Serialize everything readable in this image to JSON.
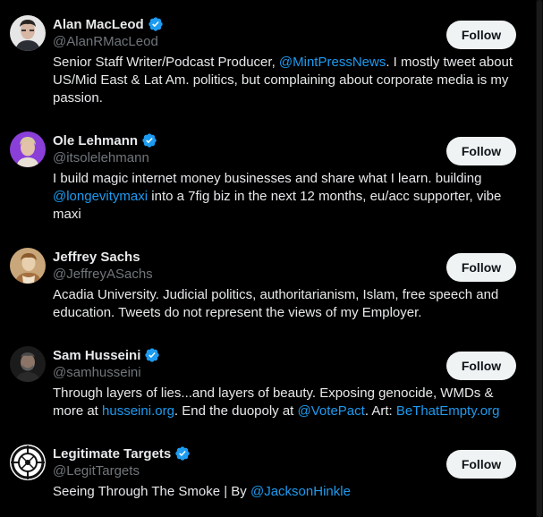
{
  "accounts": [
    {
      "name": "Alan MacLeod",
      "handle": "@AlanRMacLeod",
      "verified": true,
      "follow_label": "Follow",
      "avatar_icon": "person-portrait-light-background",
      "bio": [
        {
          "text": "Senior Staff Writer/Podcast Producer, ",
          "link": false
        },
        {
          "text": "@MintPressNews",
          "link": true
        },
        {
          "text": ". I mostly tweet about US/Mid East & Lat Am. politics, but complaining about corporate media is my passion.",
          "link": false
        }
      ]
    },
    {
      "name": "Ole Lehmann",
      "handle": "@itsolelehmann",
      "verified": true,
      "follow_label": "Follow",
      "avatar_icon": "person-portrait-purple-background",
      "bio": [
        {
          "text": "I build magic internet money businesses and share what I learn. building ",
          "link": false
        },
        {
          "text": "@longevitymaxi",
          "link": true
        },
        {
          "text": " into a 7fig biz in the next 12 months, eu/acc supporter, vibe maxi",
          "link": false
        }
      ]
    },
    {
      "name": "Jeffrey Sachs",
      "handle": "@JeffreyASachs",
      "verified": false,
      "follow_label": "Follow",
      "avatar_icon": "painting-portrait",
      "bio": [
        {
          "text": "Acadia University. Judicial politics, authoritarianism, Islam, free speech and education. Tweets do not represent the views of my Employer.",
          "link": false
        }
      ]
    },
    {
      "name": "Sam Husseini",
      "handle": "@samhusseini",
      "verified": true,
      "follow_label": "Follow",
      "avatar_icon": "person-portrait-dark",
      "bio": [
        {
          "text": "Through layers of lies...and layers of beauty. Exposing genocide, WMDs & more at ",
          "link": false
        },
        {
          "text": "husseini.org",
          "link": true
        },
        {
          "text": ". End the duopoly at ",
          "link": false
        },
        {
          "text": "@VotePact",
          "link": true
        },
        {
          "text": ". Art: ",
          "link": false
        },
        {
          "text": "BeThatEmpty.org",
          "link": true
        }
      ]
    },
    {
      "name": "Legitimate Targets",
      "handle": "@LegitTargets",
      "verified": true,
      "follow_label": "Follow",
      "avatar_icon": "crosshair-target-logo",
      "bio": [
        {
          "text": "Seeing Through The Smoke | By ",
          "link": false
        },
        {
          "text": "@JacksonHinkle",
          "link": true
        }
      ]
    }
  ],
  "colors": {
    "background": "#000000",
    "text": "#e7e9ea",
    "secondary_text": "#71767b",
    "link": "#1d9bf0",
    "verified_badge": "#1d9bf0",
    "button_bg": "#eff3f4",
    "button_text": "#0f1419"
  }
}
